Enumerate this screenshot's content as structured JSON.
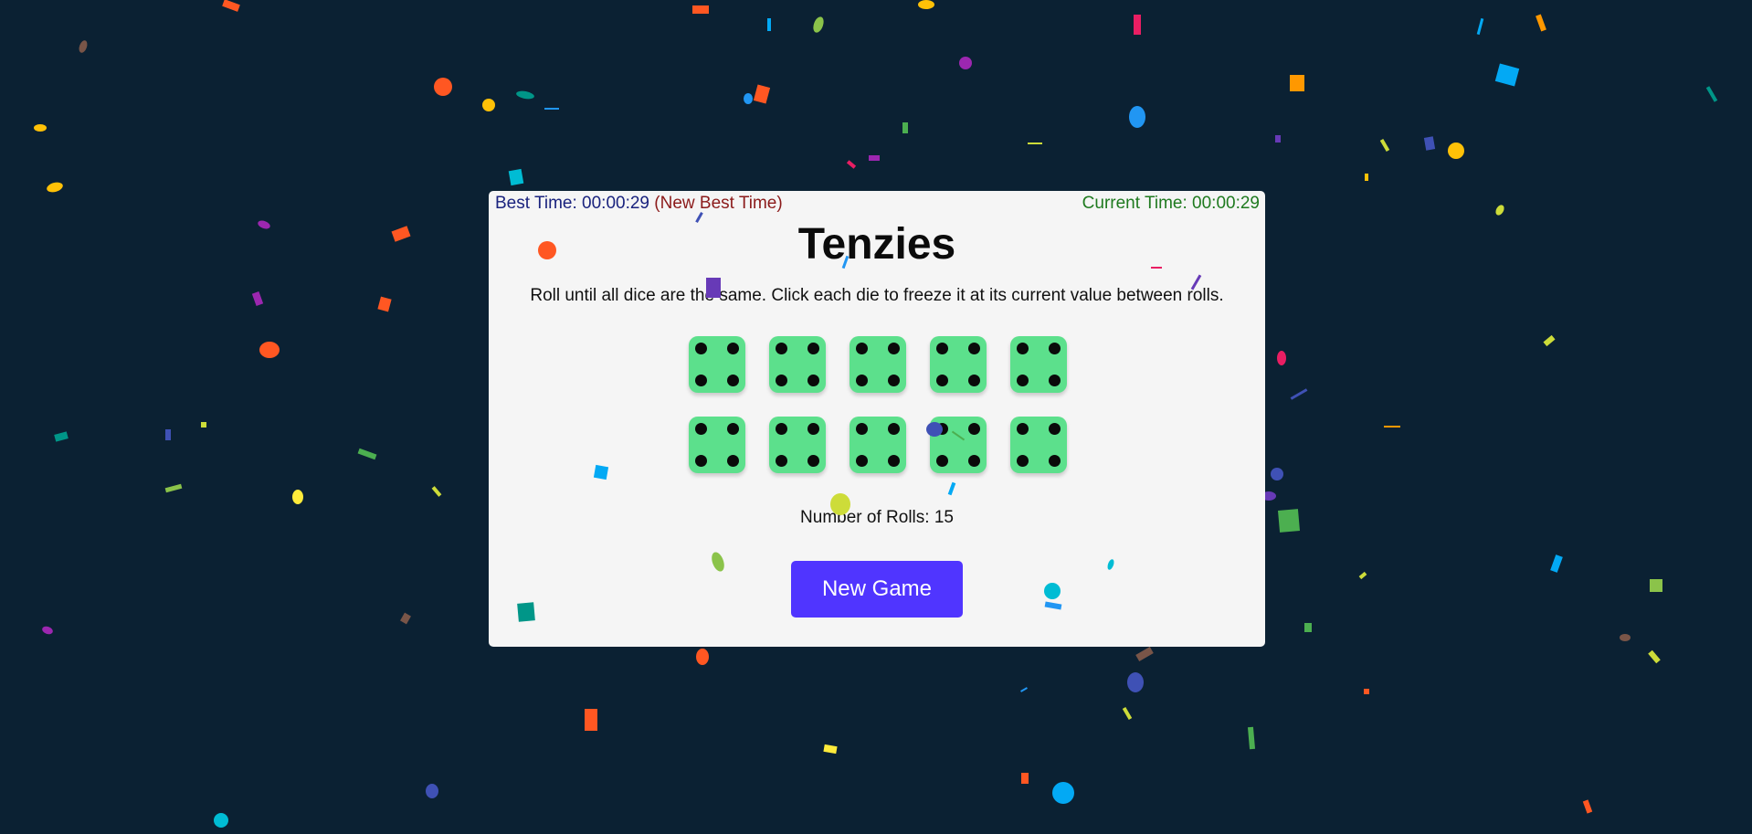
{
  "header": {
    "best_time_label": "Best Time: 00:00:29",
    "new_best_label": "(New Best Time)",
    "current_time_label": "Current Time: 00:00:29"
  },
  "title": "Tenzies",
  "instructions": "Roll until all dice are the same. Click each die to freeze it at its current value between rolls.",
  "dice": [
    {
      "value": 4,
      "held": true
    },
    {
      "value": 4,
      "held": true
    },
    {
      "value": 4,
      "held": true
    },
    {
      "value": 4,
      "held": true
    },
    {
      "value": 4,
      "held": true
    },
    {
      "value": 4,
      "held": true
    },
    {
      "value": 4,
      "held": true
    },
    {
      "value": 4,
      "held": true
    },
    {
      "value": 4,
      "held": true
    },
    {
      "value": 4,
      "held": true
    }
  ],
  "rolls_label": "Number of Rolls: 15",
  "new_game_label": "New Game",
  "colors": {
    "background": "#0b2133",
    "card": "#f5f5f5",
    "die_held": "#5ce08c",
    "button": "#5035ff",
    "best_time": "#1a237e",
    "new_best": "#8b1a1a",
    "current_time": "#1f7a1f"
  }
}
